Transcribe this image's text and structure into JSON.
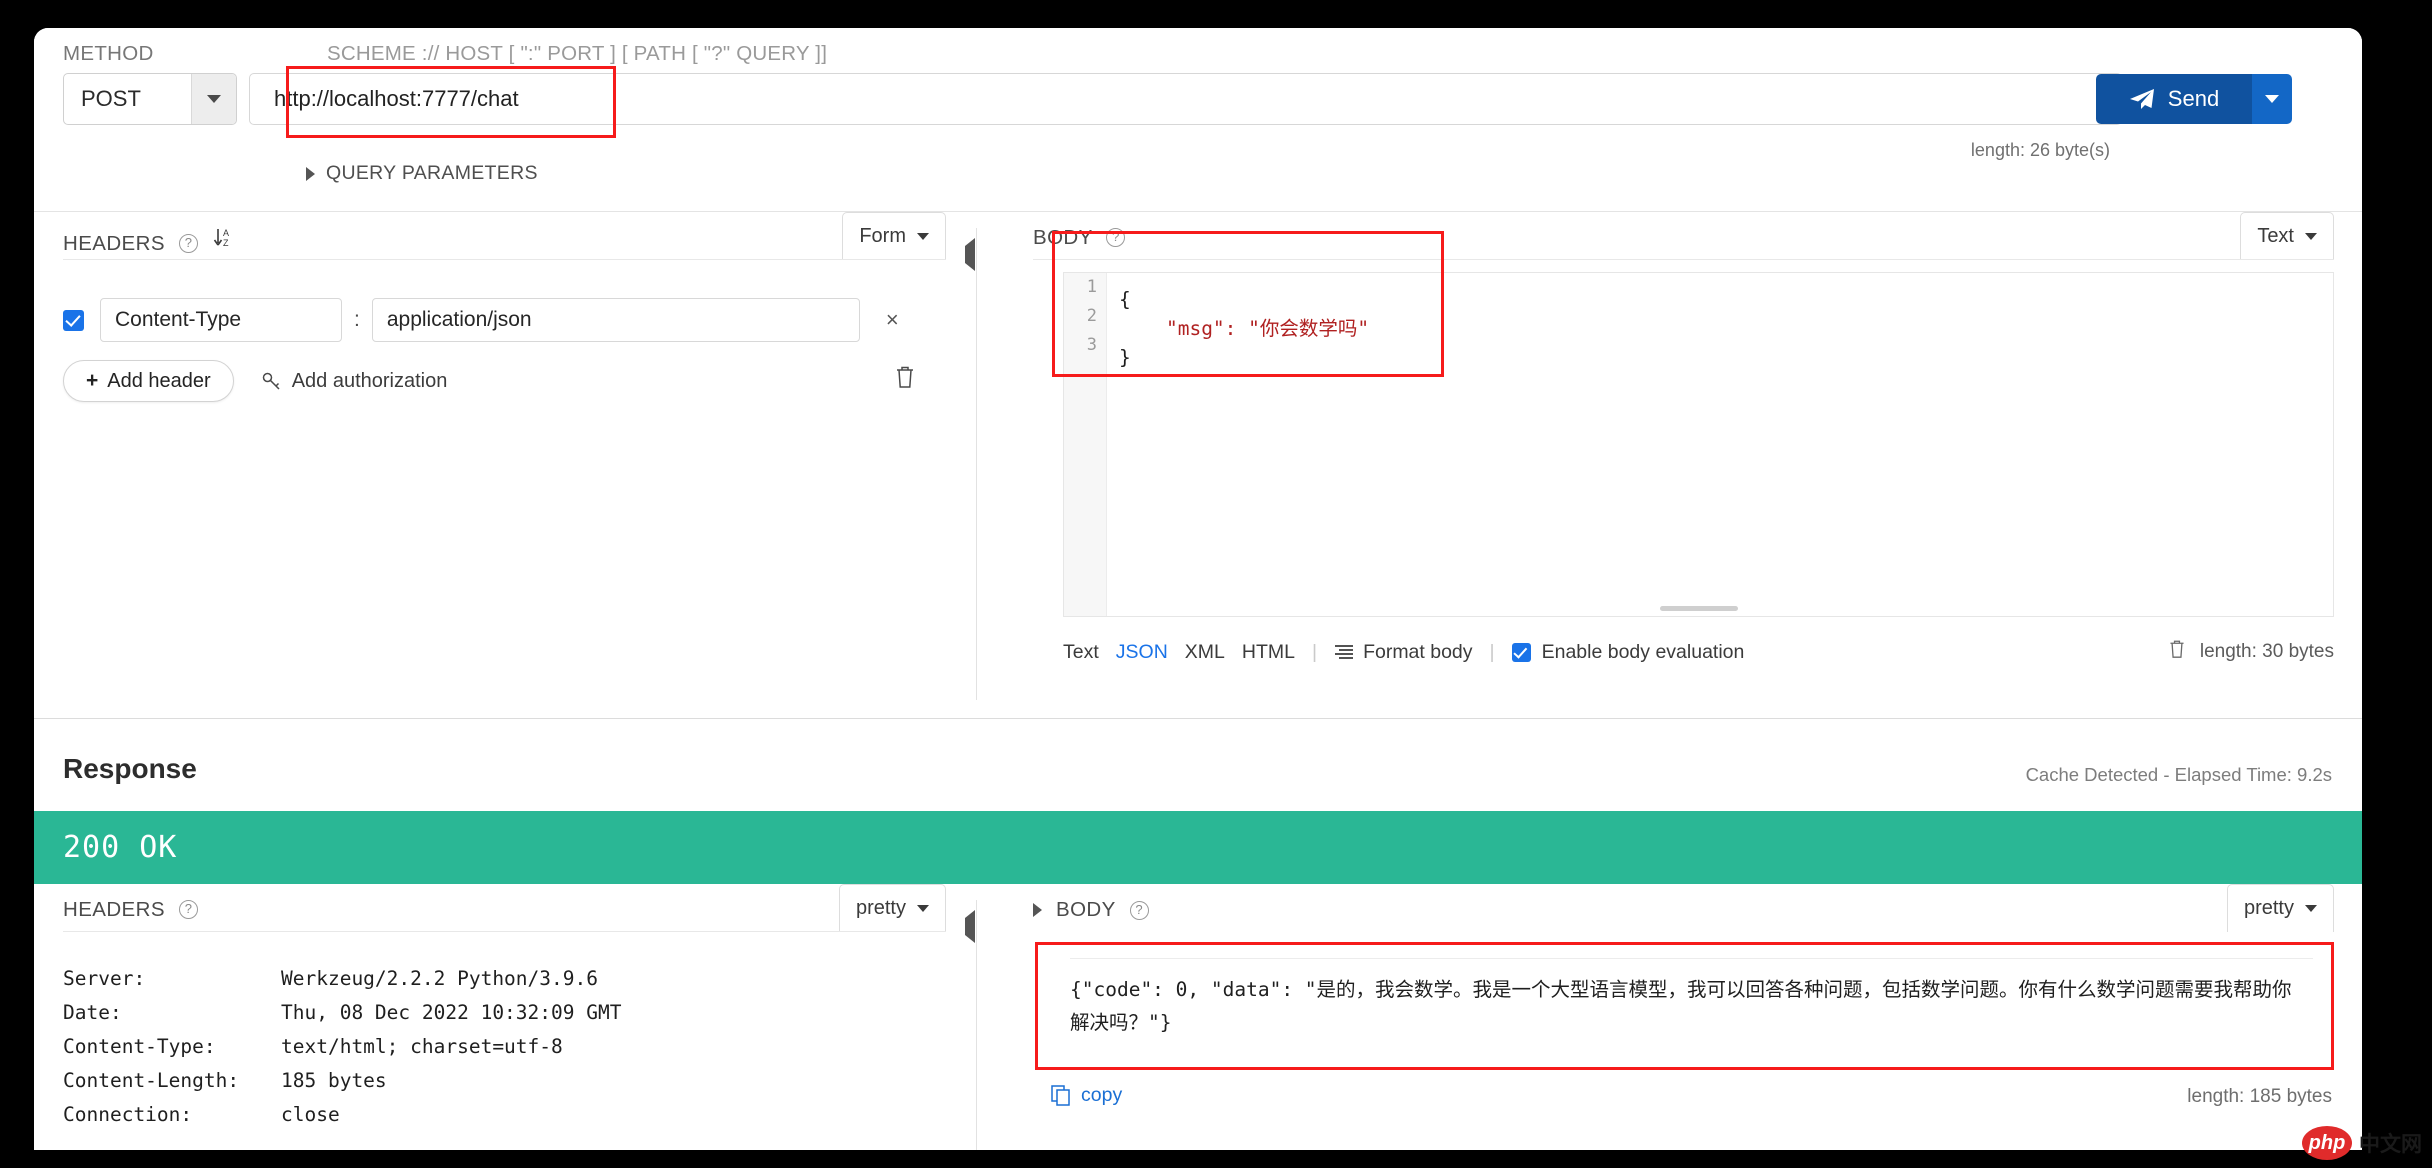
{
  "request": {
    "labels": {
      "method": "METHOD",
      "scheme": "SCHEME :// HOST [ \":\" PORT ] [ PATH [ \"?\" QUERY ]]",
      "query_parameters": "QUERY PARAMETERS"
    },
    "method": "POST",
    "url": "http://localhost:7777/chat",
    "url_placeholder": "http://localhost:7777/chat",
    "send_label": "Send",
    "url_length": "length: 26 byte(s)",
    "headers_panel": {
      "title": "HEADERS",
      "view_mode": "Form",
      "rows": [
        {
          "enabled": true,
          "key": "Content-Type",
          "value": "application/json",
          "remove": "×"
        }
      ],
      "add_header_label": "Add header",
      "add_authorization_label": "Add authorization"
    },
    "body_panel": {
      "title": "BODY",
      "view_mode": "Text",
      "line_numbers": [
        "1",
        "2",
        "3"
      ],
      "code_lines": [
        {
          "plain": "{",
          "string": ""
        },
        {
          "prefix": "    ",
          "string": "\"msg\": \"你会数学吗\""
        },
        {
          "plain": "}",
          "string": ""
        }
      ],
      "footer": {
        "tabs": [
          "Text",
          "JSON",
          "XML",
          "HTML"
        ],
        "active_tab": "JSON",
        "format_body_label": "Format body",
        "enable_body_evaluation_label": "Enable body evaluation",
        "enable_body_evaluation_checked": true,
        "length": "length: 30 bytes"
      }
    }
  },
  "response": {
    "title": "Response",
    "meta": "Cache Detected - Elapsed Time: 9.2s",
    "status": "200 OK",
    "status_color": "#2ab795",
    "headers_panel": {
      "title": "HEADERS",
      "view_mode": "pretty",
      "rows": [
        {
          "key": "Server:",
          "value": "Werkzeug/2.2.2 Python/3.9.6"
        },
        {
          "key": "Date:",
          "value": "Thu, 08 Dec 2022 10:32:09 GMT"
        },
        {
          "key": "Content-Type:",
          "value": "text/html; charset=utf-8"
        },
        {
          "key": "Content-Length:",
          "value": "185 bytes"
        },
        {
          "key": "Connection:",
          "value": "close"
        }
      ]
    },
    "body_panel": {
      "title": "BODY",
      "view_mode": "pretty",
      "content": "{\"code\": 0, \"data\": \"是的，我会数学。我是一个大型语言模型，我可以回答各种问题，包括数学问题。你有什么数学问题需要我帮助你解决吗？\"}",
      "copy_label": "copy",
      "length": "length: 185 bytes"
    }
  },
  "watermark": {
    "badge": "php",
    "text": "中文网"
  }
}
